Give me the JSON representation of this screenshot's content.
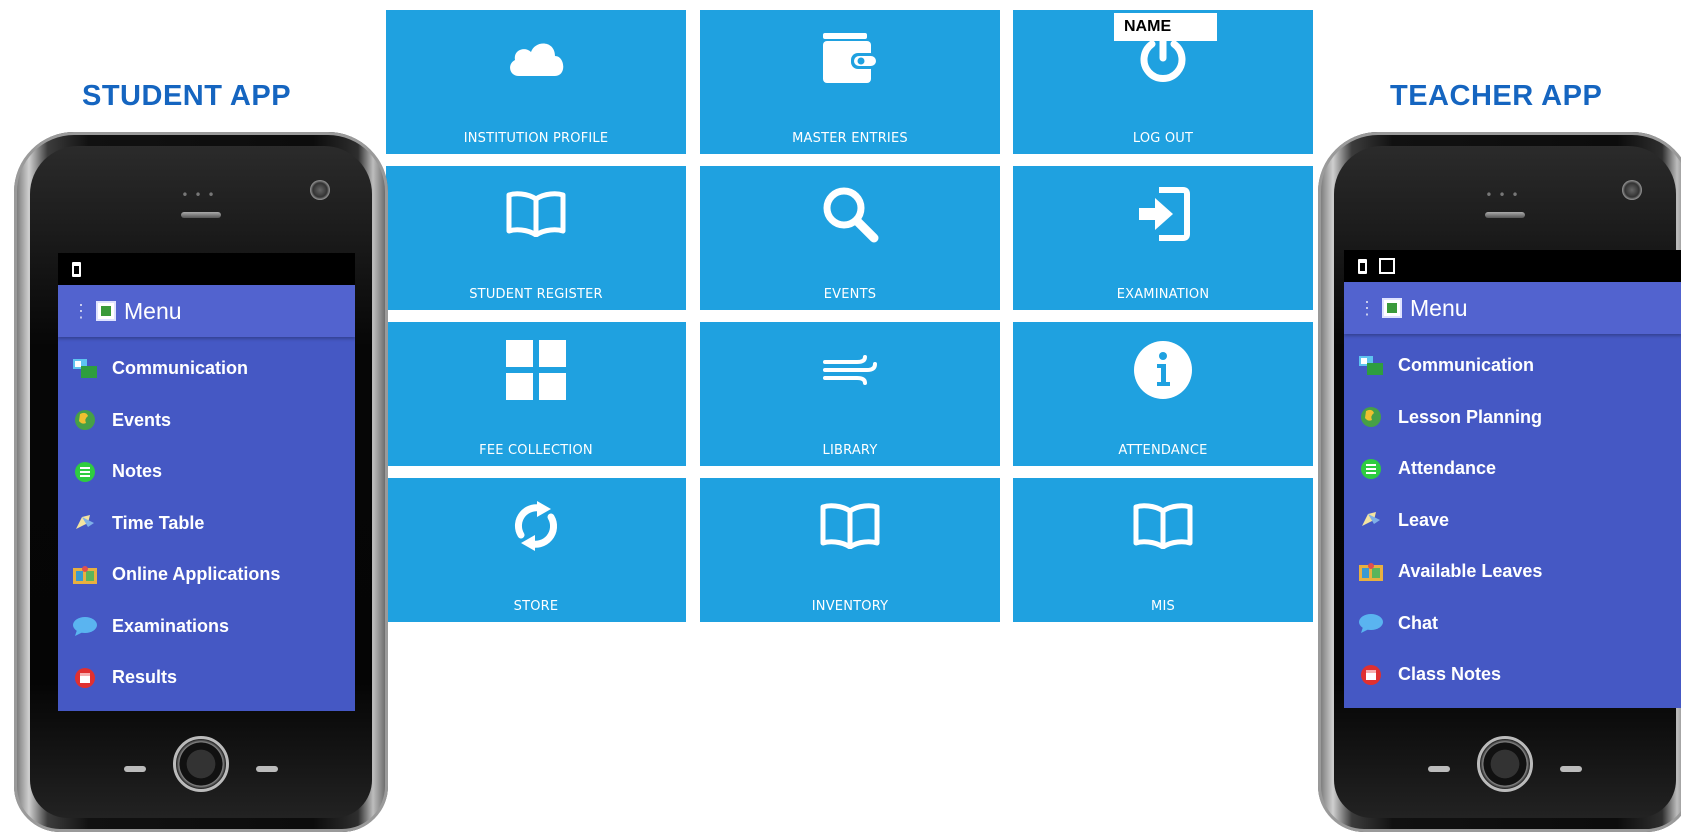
{
  "student_app": {
    "title": "STUDENT APP",
    "menu_title": "Menu",
    "items": [
      {
        "label": "Communication",
        "icon": "communication-icon"
      },
      {
        "label": "Events",
        "icon": "globe-icon"
      },
      {
        "label": "Notes",
        "icon": "notes-icon"
      },
      {
        "label": "Time Table",
        "icon": "timetable-icon"
      },
      {
        "label": "Online Applications",
        "icon": "applications-icon"
      },
      {
        "label": "Examinations",
        "icon": "chat-bubble-icon"
      },
      {
        "label": "Results",
        "icon": "calendar-icon"
      }
    ]
  },
  "teacher_app": {
    "title": "TEACHER APP",
    "menu_title": "Menu",
    "items": [
      {
        "label": "Communication",
        "icon": "communication-icon"
      },
      {
        "label": "Lesson Planning",
        "icon": "globe-icon"
      },
      {
        "label": "Attendance",
        "icon": "notes-icon"
      },
      {
        "label": "Leave",
        "icon": "timetable-icon"
      },
      {
        "label": "Available Leaves",
        "icon": "applications-icon"
      },
      {
        "label": "Chat",
        "icon": "chat-bubble-icon"
      },
      {
        "label": "Class Notes",
        "icon": "calendar-icon"
      }
    ]
  },
  "dashboard": {
    "name_label": "NAME",
    "tiles": [
      {
        "label": "INSTITUTION PROFILE",
        "icon": "cloud-icon"
      },
      {
        "label": "MASTER ENTRIES",
        "icon": "wallet-icon"
      },
      {
        "label": "LOG OUT",
        "icon": "power-icon"
      },
      {
        "label": "STUDENT REGISTER",
        "icon": "book-icon"
      },
      {
        "label": "EVENTS",
        "icon": "search-icon"
      },
      {
        "label": "EXAMINATION",
        "icon": "sign-in-icon"
      },
      {
        "label": "FEE COLLECTION",
        "icon": "grid-icon"
      },
      {
        "label": "LIBRARY",
        "icon": "wind-icon"
      },
      {
        "label": "ATTENDANCE",
        "icon": "info-icon"
      },
      {
        "label": "STORE",
        "icon": "refresh-icon"
      },
      {
        "label": "INVENTORY",
        "icon": "book-icon"
      },
      {
        "label": "MIS",
        "icon": "book-icon"
      }
    ]
  },
  "colors": {
    "tile_bg": "#1fa1e0",
    "title_blue": "#1565c0",
    "menu_bg": "#4558c4"
  }
}
